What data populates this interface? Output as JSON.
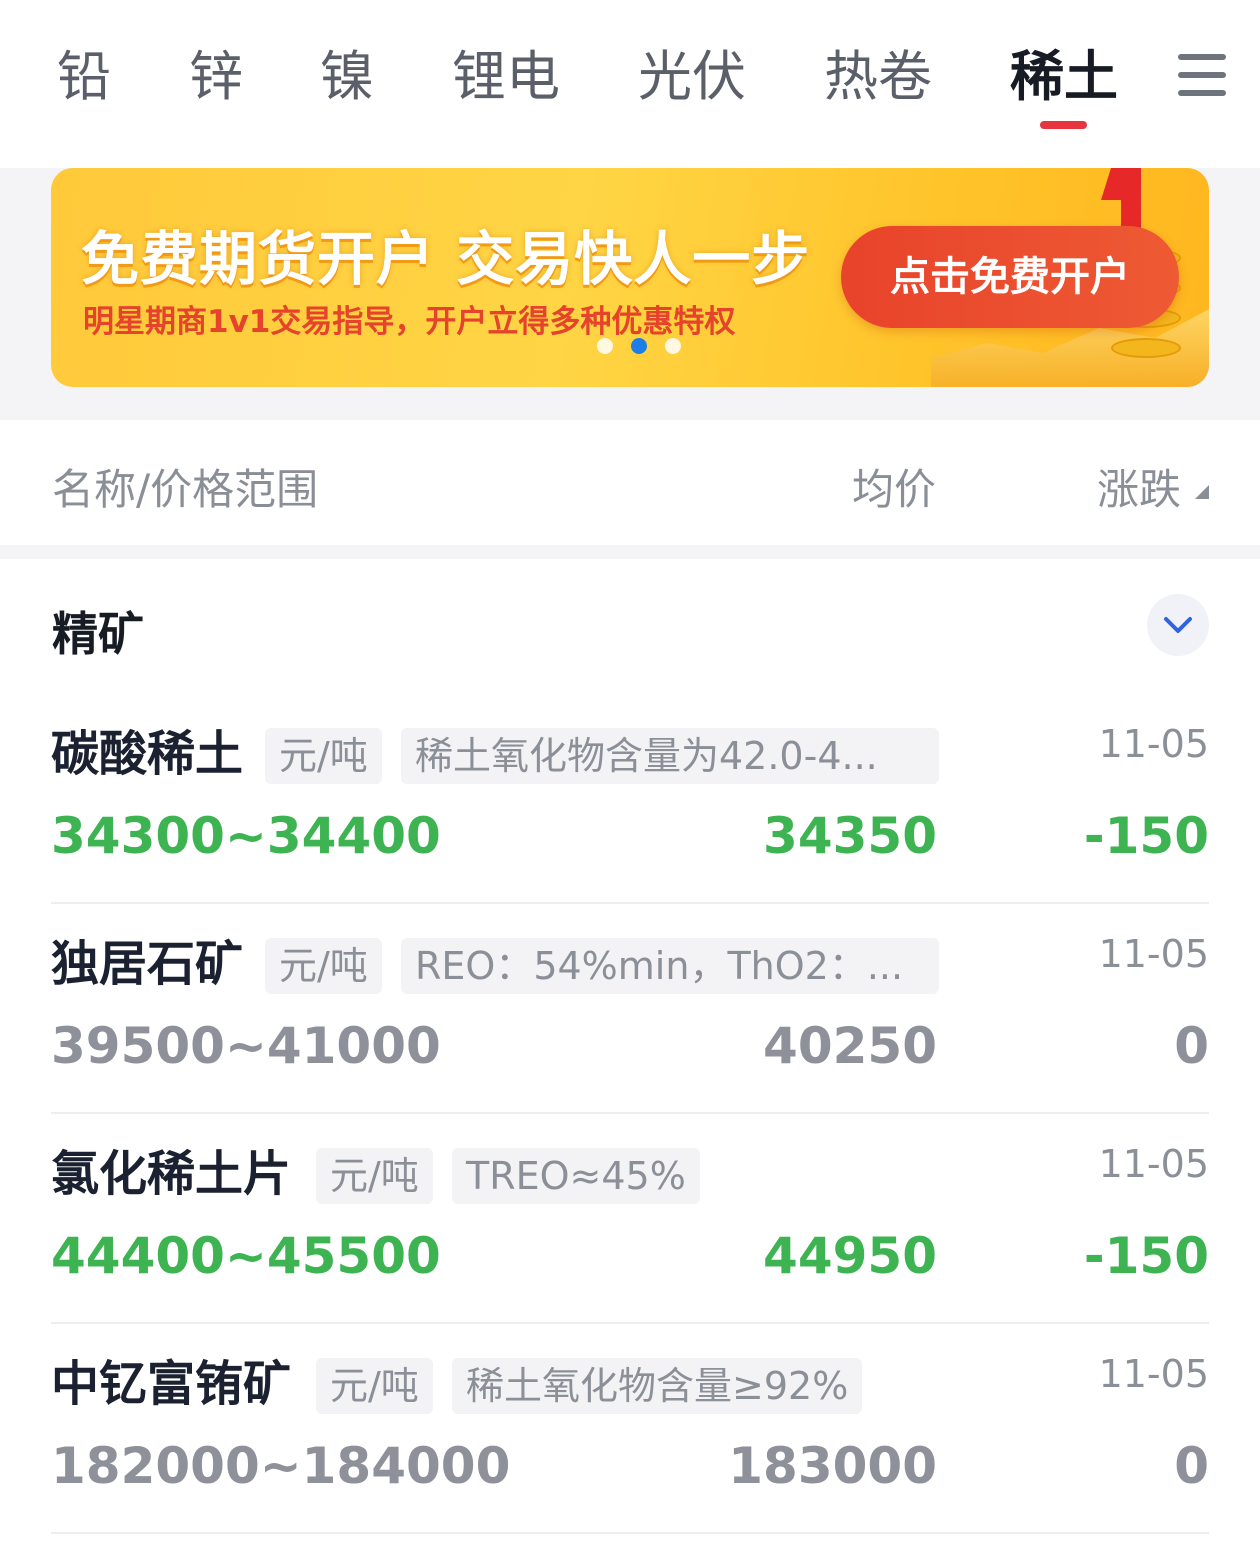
{
  "tabs": [
    {
      "label": "铅"
    },
    {
      "label": "锌"
    },
    {
      "label": "镍"
    },
    {
      "label": "锂电"
    },
    {
      "label": "光伏"
    },
    {
      "label": "热卷"
    },
    {
      "label": "稀土",
      "active": true
    }
  ],
  "banner": {
    "title": "免费期货开户  交易快人一步",
    "subtitle": "明星期商1v1交易指导，开户立得多种优惠特权",
    "cta": "点击免费开户",
    "slide_count": 3,
    "active_slide": 2
  },
  "columns": {
    "name": "名称/价格范围",
    "avg": "均价",
    "change": "涨跌"
  },
  "section": {
    "title": "精矿"
  },
  "rows": [
    {
      "name": "碳酸稀土",
      "unit": "元/吨",
      "spec": "稀土氧化物含量为42.0-4...",
      "date": "11-05",
      "range": "34300~34400",
      "avg": "34350",
      "change": "-150",
      "trend": "down"
    },
    {
      "name": "独居石矿",
      "unit": "元/吨",
      "spec": "REO：54%min，ThO2：...",
      "date": "11-05",
      "range": "39500~41000",
      "avg": "40250",
      "change": "0",
      "trend": "flat"
    },
    {
      "name": "氯化稀土片",
      "unit": "元/吨",
      "spec": "TREO≈45%",
      "date": "11-05",
      "range": "44400~45500",
      "avg": "44950",
      "change": "-150",
      "trend": "down"
    },
    {
      "name": "中钇富铕矿",
      "unit": "元/吨",
      "spec": "稀土氧化物含量≥92%",
      "date": "11-05",
      "range": "182000~184000",
      "avg": "183000",
      "change": "0",
      "trend": "flat"
    }
  ],
  "colors": {
    "accent_red": "#e8343f",
    "down_green": "#3db352",
    "flat_gray": "#8e9199"
  }
}
